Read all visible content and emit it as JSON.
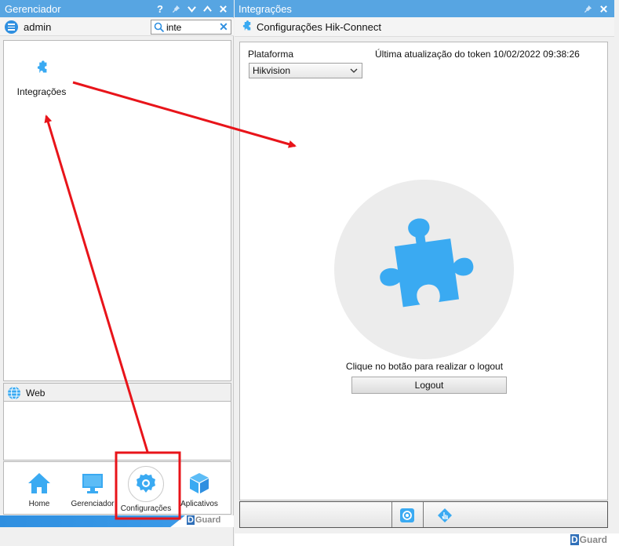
{
  "left_panel": {
    "title": "Gerenciador",
    "title_buttons": [
      "?",
      "pin",
      "chevron-down",
      "chevron-up",
      "close"
    ],
    "user": "admin",
    "search": {
      "value": "inte"
    },
    "results": [
      {
        "label": "Integrações",
        "icon": "puzzle-icon"
      }
    ],
    "web_section": {
      "label": "Web",
      "icon": "globe-icon"
    },
    "bottom_nav": [
      {
        "label": "Home",
        "icon": "home-icon"
      },
      {
        "label": "Gerenciador",
        "icon": "monitor-icon"
      },
      {
        "label": "Configurações",
        "icon": "gear-icon",
        "selected": true
      },
      {
        "label": "Aplicativos",
        "icon": "cube-icon"
      }
    ],
    "brand": "Guard",
    "brand_mark": "D"
  },
  "right_panel": {
    "title": "Integrações",
    "subtitle": "Configurações Hik-Connect",
    "platform_label": "Plataforma",
    "platform_value": "Hikvision",
    "token_label": "Última atualização do token 10/02/2022 09:38:26",
    "logout_instruction": "Clique no botão para realizar o logout",
    "logout_button": "Logout",
    "brand": "Guard",
    "brand_mark": "D"
  },
  "colors": {
    "titlebar": "#57a5e2",
    "accent": "#2f8fe0",
    "icon_blue": "#3aaaf2",
    "annotation_red": "#e8141a"
  }
}
